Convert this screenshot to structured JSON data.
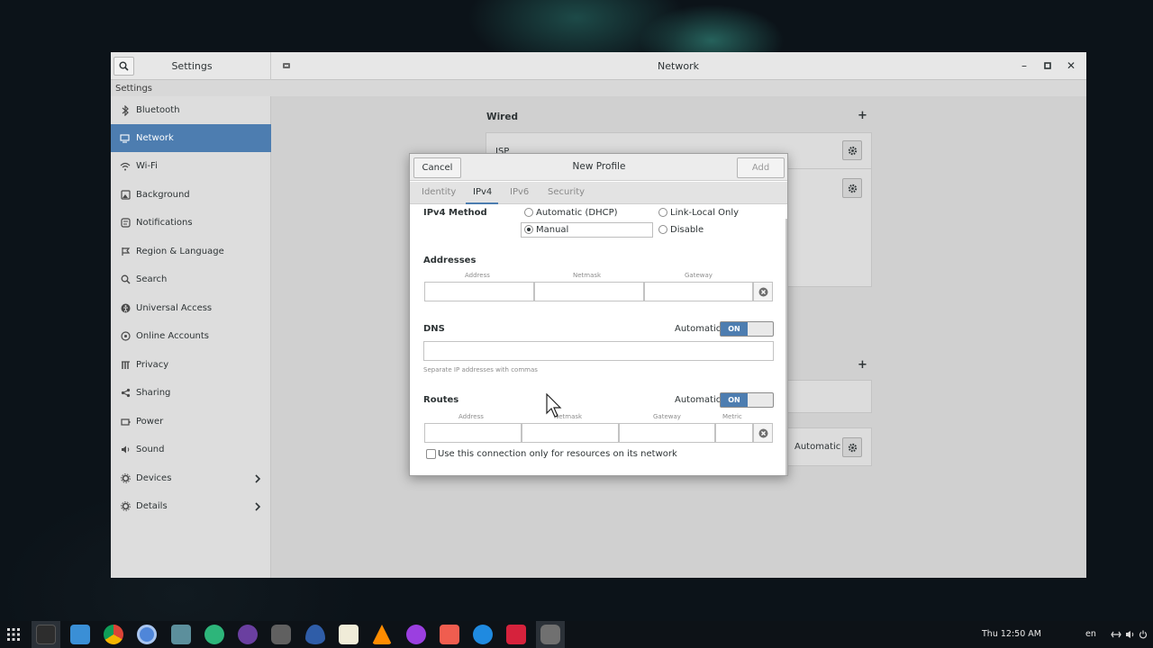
{
  "window": {
    "sidebar_title": "Settings",
    "panel_title": "Network",
    "subheader": "Settings",
    "controls": [
      "minimize-icon",
      "maximize-icon",
      "close-icon"
    ]
  },
  "sidebar": {
    "items": [
      {
        "label": "Bluetooth",
        "icon": "bluetooth-icon"
      },
      {
        "label": "Network",
        "icon": "network-icon",
        "active": true
      },
      {
        "label": "Wi-Fi",
        "icon": "wifi-icon"
      },
      {
        "label": "Background",
        "icon": "background-icon"
      },
      {
        "label": "Notifications",
        "icon": "notifications-icon"
      },
      {
        "label": "Region & Language",
        "icon": "region-icon"
      },
      {
        "label": "Search",
        "icon": "search-icon"
      },
      {
        "label": "Universal Access",
        "icon": "universal-access-icon"
      },
      {
        "label": "Online Accounts",
        "icon": "online-accounts-icon"
      },
      {
        "label": "Privacy",
        "icon": "privacy-icon"
      },
      {
        "label": "Sharing",
        "icon": "sharing-icon"
      },
      {
        "label": "Power",
        "icon": "power-icon"
      },
      {
        "label": "Sound",
        "icon": "sound-icon"
      },
      {
        "label": "Devices",
        "icon": "devices-icon",
        "chevron": true
      },
      {
        "label": "Details",
        "icon": "details-icon",
        "chevron": true
      }
    ],
    "active_color": "#4d7db0"
  },
  "network": {
    "wired_title": "Wired",
    "profile_name": "ISP",
    "proxy_status": "Automatic"
  },
  "dialog": {
    "cancel_label": "Cancel",
    "title": "New Profile",
    "add_label": "Add",
    "tabs": [
      "Identity",
      "IPv4",
      "IPv6",
      "Security"
    ],
    "active_tab": "IPv4",
    "ipv4_method_label": "IPv4 Method",
    "methods": {
      "automatic": "Automatic (DHCP)",
      "link_local": "Link-Local Only",
      "manual": "Manual",
      "disable": "Disable",
      "selected": "Manual"
    },
    "addresses": {
      "title": "Addresses",
      "col_address": "Address",
      "col_netmask": "Netmask",
      "col_gateway": "Gateway",
      "address_value": "",
      "netmask_value": "",
      "gateway_value": ""
    },
    "dns": {
      "title": "DNS",
      "automatic_label": "Automatic",
      "switch_label": "ON",
      "value": "",
      "hint": "Separate IP addresses with commas"
    },
    "routes": {
      "title": "Routes",
      "automatic_label": "Automatic",
      "switch_label": "ON",
      "col_address": "Address",
      "col_netmask": "Netmask",
      "col_gateway": "Gateway",
      "col_metric": "Metric",
      "only_resources_label": "Use this connection only for resources on its network"
    }
  },
  "taskbar": {
    "clock": "Thu 12:50 AM",
    "language": "en",
    "apps": [
      "app-grid-icon",
      "terminal-icon",
      "files-icon",
      "chrome-icon",
      "chromium-icon",
      "visual-studio-icon",
      "chat-icon",
      "tor-icon",
      "settings-icon",
      "water-icon",
      "notes-icon",
      "vlc-icon",
      "music-icon",
      "screenshot-icon",
      "firefox-icon",
      "recorder-icon",
      "settings-active-icon"
    ],
    "tray": [
      "network-tray-icon",
      "volume-icon",
      "power-tray-icon"
    ]
  }
}
